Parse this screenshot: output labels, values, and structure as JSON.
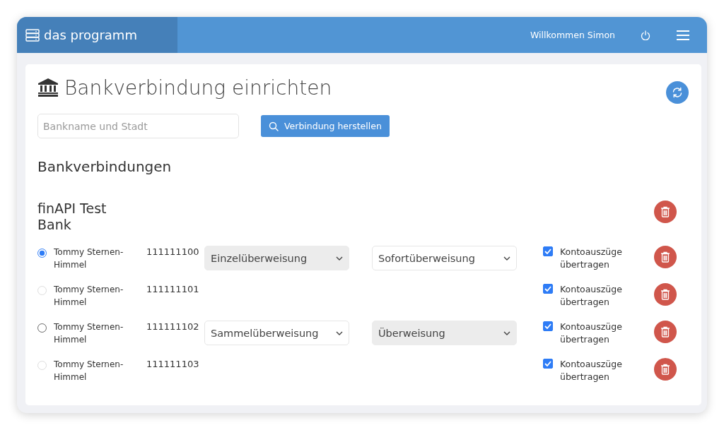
{
  "header": {
    "brand": "das programm",
    "welcome": "Willkommen Simon"
  },
  "page": {
    "title": "Bankverbindung einrichten",
    "search": {
      "placeholder": "Bankname und Stadt"
    },
    "connect_button": "Verbindung herstellen",
    "section_title": "Bankverbindungen"
  },
  "banks": [
    {
      "name": "finAPI Test Bank",
      "accounts": [
        {
          "holder": "Tommy Sternen-Himmel",
          "number": "111111100",
          "radio": {
            "selected": true,
            "disabled": false
          },
          "selects": [
            {
              "value": "Einzelüberweisung",
              "disabled": true
            },
            {
              "value": "Sofortüberweisung",
              "disabled": false
            }
          ],
          "statements": {
            "label": "Kontoauszüge übertragen",
            "checked": true
          }
        },
        {
          "holder": "Tommy Sternen-Himmel",
          "number": "111111101",
          "radio": {
            "selected": false,
            "disabled": true
          },
          "statements": {
            "label": "Kontoauszüge übertragen",
            "checked": true
          }
        },
        {
          "holder": "Tommy Sternen-Himmel",
          "number": "111111102",
          "radio": {
            "selected": false,
            "disabled": false
          },
          "selects": [
            {
              "value": "Sammelüberweisung",
              "disabled": false
            },
            {
              "value": "Überweisung",
              "disabled": true
            }
          ],
          "statements": {
            "label": "Kontoauszüge übertragen",
            "checked": true
          }
        },
        {
          "holder": "Tommy Sternen-Himmel",
          "number": "111111103",
          "radio": {
            "selected": false,
            "disabled": true
          },
          "statements": {
            "label": "Kontoauszüge übertragen",
            "checked": true
          }
        }
      ]
    }
  ]
}
